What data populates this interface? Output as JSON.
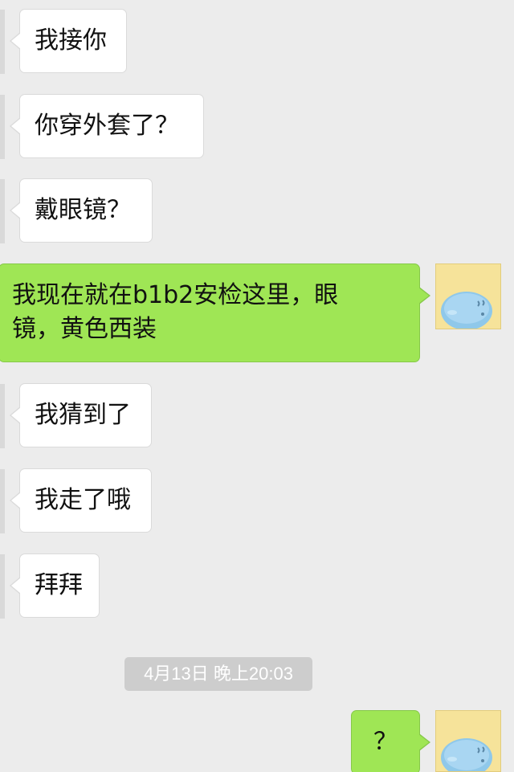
{
  "conversation": {
    "incoming_1": "我接你",
    "incoming_2": "你穿外套了？",
    "incoming_3": "戴眼镜？",
    "outgoing_1": "我现在就在b1b2安检这里，眼镜，黄色西装",
    "incoming_4": "我猜到了",
    "incoming_5": "我走了哦",
    "incoming_6": "拜拜",
    "timestamp": "4月13日 晚上20:03",
    "outgoing_2": "？"
  },
  "colors": {
    "background": "#ececec",
    "incoming_bubble": "#ffffff",
    "outgoing_bubble": "#9fe655",
    "avatar_bg": "#f6e39a",
    "avatar_character": "#8fc8ea"
  },
  "icons": {
    "avatar": "blue-blob-character-icon"
  }
}
